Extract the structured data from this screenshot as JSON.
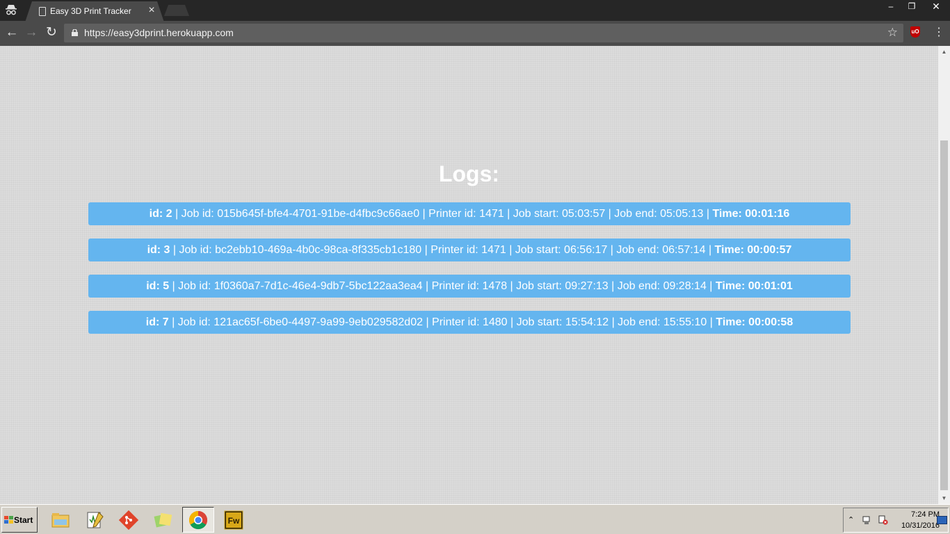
{
  "browser": {
    "tab_title": "Easy 3D Print Tracker",
    "url": "https://easy3dprint.herokuapp.com",
    "window_controls": {
      "minimize": "–",
      "maximize": "❐",
      "close": "✕"
    }
  },
  "page": {
    "heading": "Logs:",
    "logs": [
      {
        "id_label": "id: 2",
        "middle": " | Job id: 015b645f-bfe4-4701-91be-d4fbc9c66ae0 | Printer id: 1471 | Job start: 05:03:57 | Job end: 05:05:13 | ",
        "time_label": "Time: 00:01:16"
      },
      {
        "id_label": "id: 3",
        "middle": " | Job id: bc2ebb10-469a-4b0c-98ca-8f335cb1c180 | Printer id: 1471 | Job start: 06:56:17 | Job end: 06:57:14 | ",
        "time_label": "Time: 00:00:57"
      },
      {
        "id_label": "id: 5",
        "middle": " | Job id: 1f0360a7-7d1c-46e4-9db7-5bc122aa3ea4 | Printer id: 1478 | Job start: 09:27:13 | Job end: 09:28:14 | ",
        "time_label": "Time: 00:01:01"
      },
      {
        "id_label": "id: 7",
        "middle": " | Job id: 121ac65f-6be0-4497-9a99-9eb029582d02 | Printer id: 1480 | Job start: 15:54:12 | Job end: 15:55:10 | ",
        "time_label": "Time: 00:00:58"
      }
    ]
  },
  "taskbar": {
    "start_label": "Start",
    "apps": [
      {
        "name": "file-explorer-icon",
        "active": false
      },
      {
        "name": "notepad-icon",
        "active": false
      },
      {
        "name": "git-icon",
        "active": false
      },
      {
        "name": "sticky-notes-icon",
        "active": false
      },
      {
        "name": "chrome-icon",
        "active": true
      },
      {
        "name": "fireworks-icon",
        "active": false,
        "label": "Fw"
      }
    ],
    "clock_time": "7:24 PM",
    "clock_date": "10/31/2016"
  },
  "colors": {
    "log_row_bg": "#64b5ef",
    "page_bg": "#dcdcdc",
    "chrome_dark": "#262626",
    "toolbar": "#4a4a4a"
  }
}
